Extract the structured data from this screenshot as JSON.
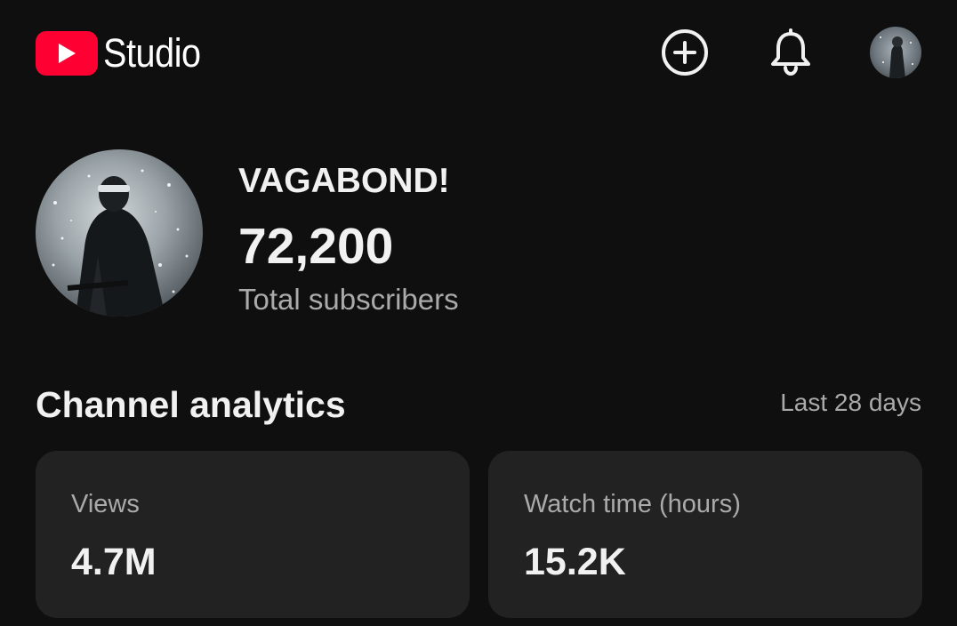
{
  "header": {
    "logo_text": "Studio",
    "brand_color": "#ff0033",
    "icons": [
      "youtube-play-icon",
      "create-plus-icon",
      "bell-icon",
      "account-avatar"
    ]
  },
  "channel": {
    "name": "VAGABOND!",
    "subscribers": "72,200",
    "subscribers_label": "Total subscribers"
  },
  "analytics": {
    "title": "Channel analytics",
    "range": "Last 28 days",
    "cards": [
      {
        "label": "Views",
        "value": "4.7M"
      },
      {
        "label": "Watch time (hours)",
        "value": "15.2K"
      }
    ]
  }
}
